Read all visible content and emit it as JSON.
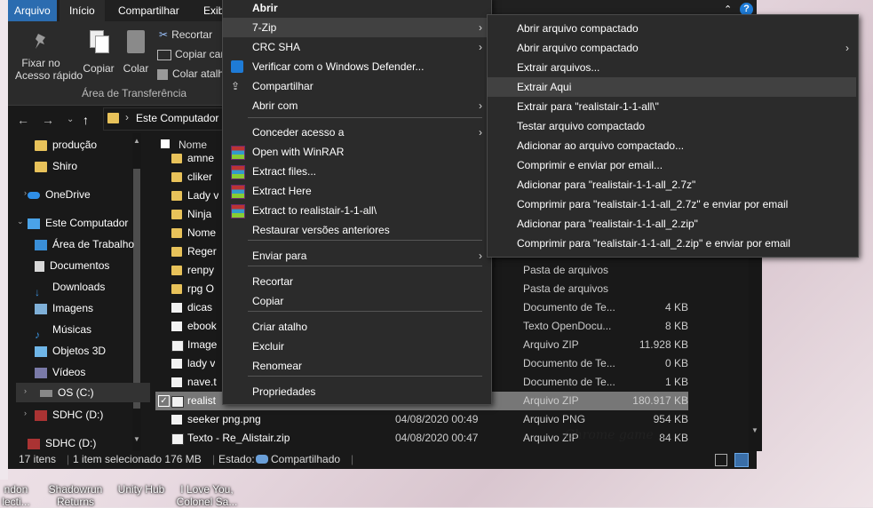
{
  "ribbon": {
    "tabs": [
      "Arquivo",
      "Início",
      "Compartilhar",
      "Exib"
    ],
    "pin_label": "Fixar no\nAcesso rápido",
    "copy_label": "Copiar",
    "paste_label": "Colar",
    "cut_label": "Recortar",
    "copy_path_label": "Copiar cam",
    "paste_shortcut_label": "Colar atalh",
    "group_label": "Área de Transferência"
  },
  "address": {
    "path": "Este Computador"
  },
  "sidebar": {
    "items": [
      {
        "label": "produção",
        "icon": "folder-icon"
      },
      {
        "label": "Shiro",
        "icon": "folder-icon"
      },
      {
        "label": "OneDrive",
        "icon": "cloud-icon"
      },
      {
        "label": "Este Computador",
        "icon": "computer-icon"
      },
      {
        "label": "Área de Trabalho",
        "icon": "desktop-icon"
      },
      {
        "label": "Documentos",
        "icon": "documents-icon"
      },
      {
        "label": "Downloads",
        "icon": "downloads-icon"
      },
      {
        "label": "Imagens",
        "icon": "pictures-icon"
      },
      {
        "label": "Músicas",
        "icon": "music-icon"
      },
      {
        "label": "Objetos 3D",
        "icon": "objects3d-icon"
      },
      {
        "label": "Vídeos",
        "icon": "videos-icon"
      },
      {
        "label": "OS (C:)",
        "icon": "drive-icon"
      },
      {
        "label": "SDHC (D:)",
        "icon": "sd-icon"
      },
      {
        "label": "SDHC (D:)",
        "icon": "sd-icon"
      }
    ]
  },
  "files": {
    "header_name": "Nome",
    "rows": [
      {
        "name": "amne",
        "date": "",
        "type": "",
        "size": "",
        "icon": "folder-icon"
      },
      {
        "name": "cliker",
        "date": "",
        "type": "",
        "size": "",
        "icon": "folder-icon"
      },
      {
        "name": "Lady v",
        "date": "",
        "type": "",
        "size": "",
        "icon": "folder-icon"
      },
      {
        "name": "Ninja",
        "date": "",
        "type": "",
        "size": "",
        "icon": "folder-icon"
      },
      {
        "name": "Nome",
        "date": "",
        "type": "",
        "size": "",
        "icon": "folder-icon"
      },
      {
        "name": "Reger",
        "date": "",
        "type": "",
        "size": "",
        "icon": "folder-icon"
      },
      {
        "name": "renpy",
        "date": "",
        "type": "Pasta de arquivos",
        "size": "",
        "icon": "folder-icon"
      },
      {
        "name": "rpg O",
        "date": "",
        "type": "Pasta de arquivos",
        "size": "",
        "icon": "folder-icon"
      },
      {
        "name": "dicas",
        "date": "",
        "type": "Documento de Te...",
        "size": "4 KB",
        "icon": "doc-icon"
      },
      {
        "name": "ebook",
        "date": "",
        "type": "Texto OpenDocu...",
        "size": "8 KB",
        "icon": "doc-icon"
      },
      {
        "name": "Image",
        "date": "",
        "type": "Arquivo ZIP",
        "size": "11.928 KB",
        "icon": "zip-icon"
      },
      {
        "name": "lady v",
        "date": "",
        "type": "Documento de Te...",
        "size": "0 KB",
        "icon": "doc-icon"
      },
      {
        "name": "nave.t",
        "date": "",
        "type": "Documento de Te...",
        "size": "1 KB",
        "icon": "doc-icon"
      },
      {
        "name": "realist",
        "date": "",
        "type": "Arquivo ZIP",
        "size": "180.917 KB",
        "icon": "zip-icon",
        "selected": true
      },
      {
        "name": "seeker png.png",
        "date": "04/08/2020 00:49",
        "type": "Arquivo PNG",
        "size": "954 KB",
        "icon": "image-icon"
      },
      {
        "name": "Texto - Re_Alistair.zip",
        "date": "04/08/2020 00:47",
        "type": "Arquivo ZIP",
        "size": "84 KB",
        "icon": "zip-icon"
      }
    ]
  },
  "status": {
    "count": "17 itens",
    "selection": "1 item selecionado  176 MB",
    "state": "Estado:",
    "shared": "Compartilhado"
  },
  "context_menu": {
    "items": [
      {
        "label": "Abrir",
        "bold": true
      },
      {
        "label": "7-Zip",
        "submenu": true,
        "hover": true
      },
      {
        "label": "CRC SHA",
        "submenu": true
      },
      {
        "label": "Verificar com o Windows Defender...",
        "icon": "defender-icon"
      },
      {
        "label": "Compartilhar",
        "icon": "share-icon"
      },
      {
        "label": "Abrir com",
        "submenu": true
      },
      {
        "label": "Conceder acesso a",
        "submenu": true
      },
      {
        "label": "Open with WinRAR",
        "icon": "winrar-icon"
      },
      {
        "label": "Extract files...",
        "icon": "winrar-icon"
      },
      {
        "label": "Extract Here",
        "icon": "winrar-icon"
      },
      {
        "label": "Extract to realistair-1-1-all\\",
        "icon": "winrar-icon"
      },
      {
        "label": "Restaurar versões anteriores"
      },
      {
        "label": "Enviar para",
        "submenu": true
      },
      {
        "label": "Recortar"
      },
      {
        "label": "Copiar"
      },
      {
        "label": "Criar atalho"
      },
      {
        "label": "Excluir"
      },
      {
        "label": "Renomear"
      },
      {
        "label": "Propriedades"
      }
    ]
  },
  "zip_menu": {
    "items": [
      {
        "label": "Abrir arquivo compactado"
      },
      {
        "label": "Abrir arquivo compactado",
        "submenu": true
      },
      {
        "label": "Extrair arquivos..."
      },
      {
        "label": "Extrair Aqui",
        "hover": true
      },
      {
        "label": "Extrair para \"realistair-1-1-all\\\""
      },
      {
        "label": "Testar arquivo compactado"
      },
      {
        "label": "Adicionar ao arquivo compactado..."
      },
      {
        "label": "Comprimir e enviar por email..."
      },
      {
        "label": "Adicionar para \"realistair-1-1-all_2.7z\""
      },
      {
        "label": "Comprimir para \"realistair-1-1-all_2.7z\" e enviar por email"
      },
      {
        "label": "Adicionar para \"realistair-1-1-all_2.zip\""
      },
      {
        "label": "Comprimir para \"realistair-1-1-all_2.zip\" e enviar por email"
      }
    ]
  },
  "desktop": {
    "icons": [
      "ndon\nlecti...",
      "Shadowrun\nReturns",
      "Unity Hub",
      "I Love You,\nColonel Sa..."
    ],
    "watermark": "Chrome game ..."
  },
  "colors": {
    "accent": "#0078d7",
    "menu_bg": "#2b2b2b",
    "hover": "#414141",
    "explorer_bg": "#191919"
  }
}
